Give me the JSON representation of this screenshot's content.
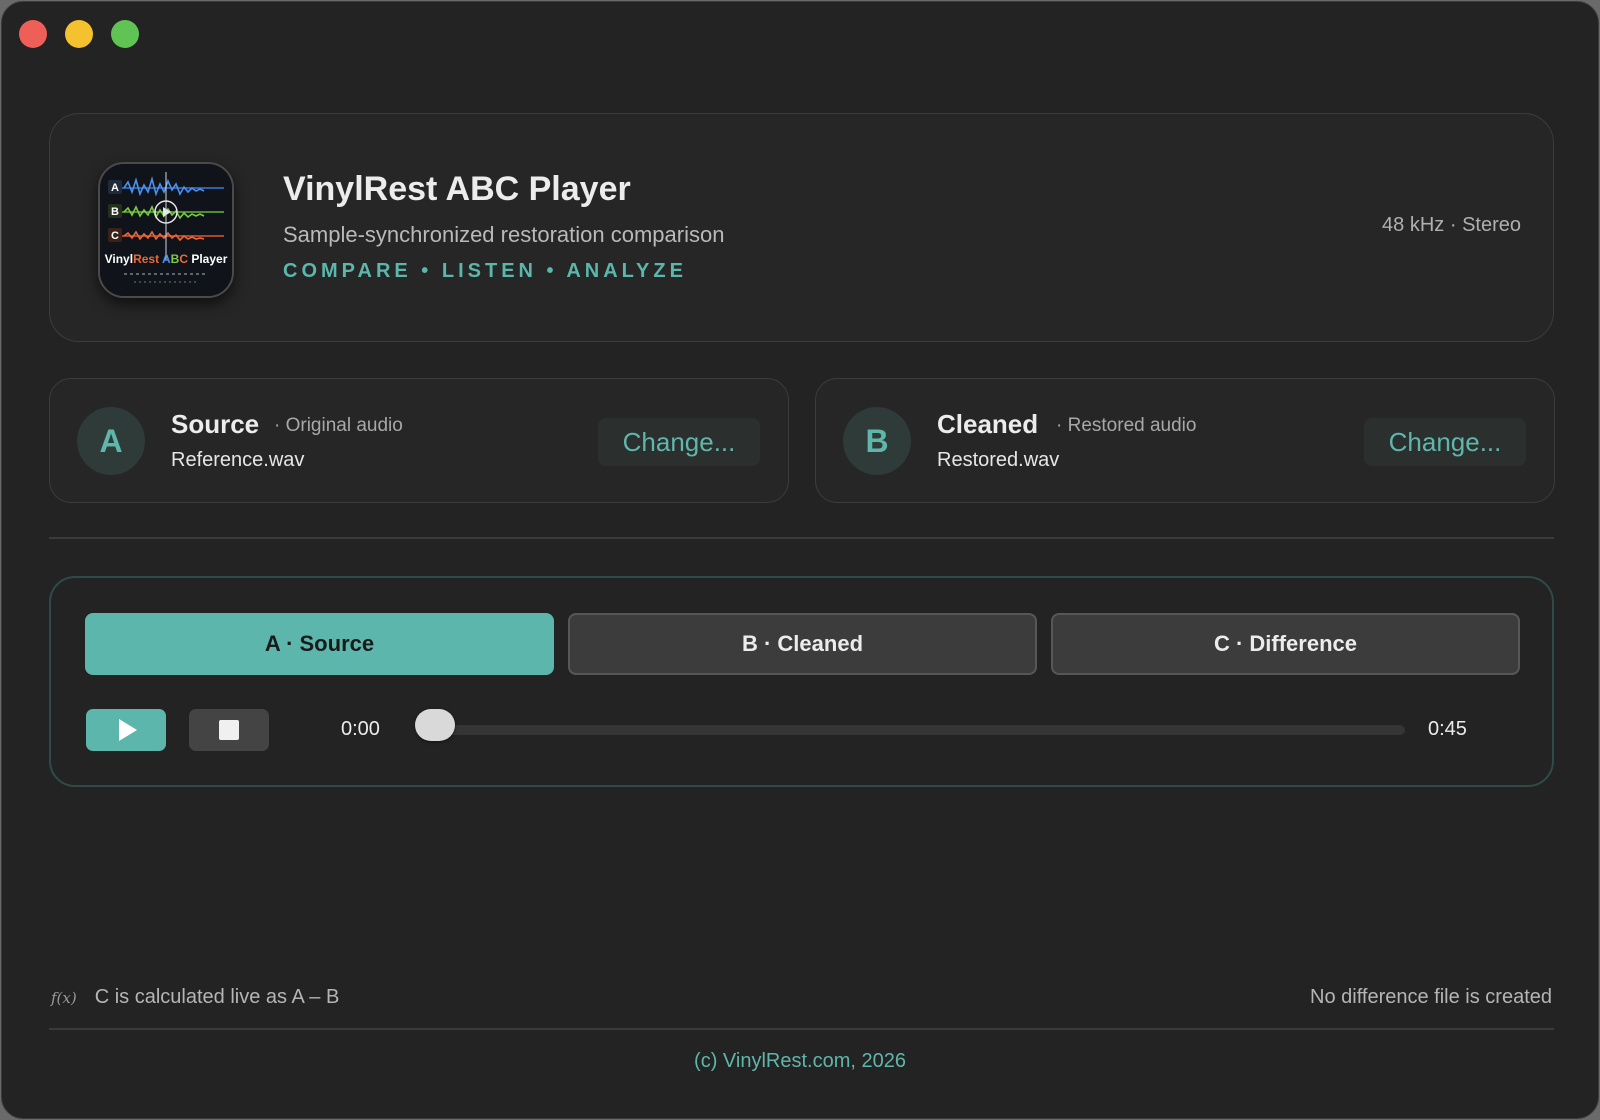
{
  "window": {
    "controls": [
      "close",
      "minimize",
      "maximize"
    ]
  },
  "header": {
    "icon_name": "vinylrest-abc-player-app-icon",
    "icon_rows": [
      "A",
      "B",
      "C"
    ],
    "icon_label_parts": [
      "Vinyl",
      "Rest",
      " A",
      "B",
      "C",
      " Player"
    ],
    "title": "VinylRest ABC Player",
    "subtitle": "Sample-synchronized restoration comparison",
    "tagline": "COMPARE • LISTEN • ANALYZE",
    "format": "48 kHz · Stereo"
  },
  "sources": {
    "a": {
      "badge": "A",
      "title": "Source",
      "desc": "· Original audio",
      "file": "Reference.wav",
      "change_label": "Change..."
    },
    "b": {
      "badge": "B",
      "title": "Cleaned",
      "desc": "· Restored audio",
      "file": "Restored.wav",
      "change_label": "Change..."
    }
  },
  "player": {
    "segments": [
      {
        "label": "A · Source",
        "active": true
      },
      {
        "label": "B · Cleaned",
        "active": false
      },
      {
        "label": "C · Difference",
        "active": false
      }
    ],
    "play_icon": "play-icon",
    "stop_icon": "stop-icon",
    "time_current": "0:00",
    "time_total": "0:45",
    "progress": 0
  },
  "footer": {
    "fx_icon": "f(x)",
    "left_note": "C is calculated live as A – B",
    "right_note": "No difference file is created",
    "copyright": "(c) VinylRest.com, 2026"
  },
  "colors": {
    "accent": "#5cb6ab",
    "background": "#232323",
    "card": "#262626",
    "close": "#ed5f57",
    "minimize": "#f4c12f",
    "maximize": "#5fc453"
  }
}
